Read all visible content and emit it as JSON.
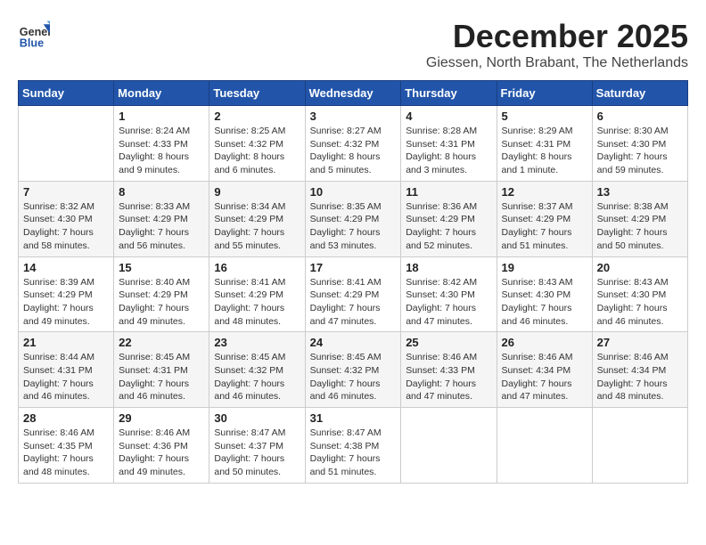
{
  "header": {
    "logo_line1": "General",
    "logo_line2": "Blue",
    "month_title": "December 2025",
    "subtitle": "Giessen, North Brabant, The Netherlands"
  },
  "days_of_week": [
    "Sunday",
    "Monday",
    "Tuesday",
    "Wednesday",
    "Thursday",
    "Friday",
    "Saturday"
  ],
  "weeks": [
    [
      {
        "day": "",
        "info": ""
      },
      {
        "day": "1",
        "info": "Sunrise: 8:24 AM\nSunset: 4:33 PM\nDaylight: 8 hours\nand 9 minutes."
      },
      {
        "day": "2",
        "info": "Sunrise: 8:25 AM\nSunset: 4:32 PM\nDaylight: 8 hours\nand 6 minutes."
      },
      {
        "day": "3",
        "info": "Sunrise: 8:27 AM\nSunset: 4:32 PM\nDaylight: 8 hours\nand 5 minutes."
      },
      {
        "day": "4",
        "info": "Sunrise: 8:28 AM\nSunset: 4:31 PM\nDaylight: 8 hours\nand 3 minutes."
      },
      {
        "day": "5",
        "info": "Sunrise: 8:29 AM\nSunset: 4:31 PM\nDaylight: 8 hours\nand 1 minute."
      },
      {
        "day": "6",
        "info": "Sunrise: 8:30 AM\nSunset: 4:30 PM\nDaylight: 7 hours\nand 59 minutes."
      }
    ],
    [
      {
        "day": "7",
        "info": "Sunrise: 8:32 AM\nSunset: 4:30 PM\nDaylight: 7 hours\nand 58 minutes."
      },
      {
        "day": "8",
        "info": "Sunrise: 8:33 AM\nSunset: 4:29 PM\nDaylight: 7 hours\nand 56 minutes."
      },
      {
        "day": "9",
        "info": "Sunrise: 8:34 AM\nSunset: 4:29 PM\nDaylight: 7 hours\nand 55 minutes."
      },
      {
        "day": "10",
        "info": "Sunrise: 8:35 AM\nSunset: 4:29 PM\nDaylight: 7 hours\nand 53 minutes."
      },
      {
        "day": "11",
        "info": "Sunrise: 8:36 AM\nSunset: 4:29 PM\nDaylight: 7 hours\nand 52 minutes."
      },
      {
        "day": "12",
        "info": "Sunrise: 8:37 AM\nSunset: 4:29 PM\nDaylight: 7 hours\nand 51 minutes."
      },
      {
        "day": "13",
        "info": "Sunrise: 8:38 AM\nSunset: 4:29 PM\nDaylight: 7 hours\nand 50 minutes."
      }
    ],
    [
      {
        "day": "14",
        "info": "Sunrise: 8:39 AM\nSunset: 4:29 PM\nDaylight: 7 hours\nand 49 minutes."
      },
      {
        "day": "15",
        "info": "Sunrise: 8:40 AM\nSunset: 4:29 PM\nDaylight: 7 hours\nand 49 minutes."
      },
      {
        "day": "16",
        "info": "Sunrise: 8:41 AM\nSunset: 4:29 PM\nDaylight: 7 hours\nand 48 minutes."
      },
      {
        "day": "17",
        "info": "Sunrise: 8:41 AM\nSunset: 4:29 PM\nDaylight: 7 hours\nand 47 minutes."
      },
      {
        "day": "18",
        "info": "Sunrise: 8:42 AM\nSunset: 4:30 PM\nDaylight: 7 hours\nand 47 minutes."
      },
      {
        "day": "19",
        "info": "Sunrise: 8:43 AM\nSunset: 4:30 PM\nDaylight: 7 hours\nand 46 minutes."
      },
      {
        "day": "20",
        "info": "Sunrise: 8:43 AM\nSunset: 4:30 PM\nDaylight: 7 hours\nand 46 minutes."
      }
    ],
    [
      {
        "day": "21",
        "info": "Sunrise: 8:44 AM\nSunset: 4:31 PM\nDaylight: 7 hours\nand 46 minutes."
      },
      {
        "day": "22",
        "info": "Sunrise: 8:45 AM\nSunset: 4:31 PM\nDaylight: 7 hours\nand 46 minutes."
      },
      {
        "day": "23",
        "info": "Sunrise: 8:45 AM\nSunset: 4:32 PM\nDaylight: 7 hours\nand 46 minutes."
      },
      {
        "day": "24",
        "info": "Sunrise: 8:45 AM\nSunset: 4:32 PM\nDaylight: 7 hours\nand 46 minutes."
      },
      {
        "day": "25",
        "info": "Sunrise: 8:46 AM\nSunset: 4:33 PM\nDaylight: 7 hours\nand 47 minutes."
      },
      {
        "day": "26",
        "info": "Sunrise: 8:46 AM\nSunset: 4:34 PM\nDaylight: 7 hours\nand 47 minutes."
      },
      {
        "day": "27",
        "info": "Sunrise: 8:46 AM\nSunset: 4:34 PM\nDaylight: 7 hours\nand 48 minutes."
      }
    ],
    [
      {
        "day": "28",
        "info": "Sunrise: 8:46 AM\nSunset: 4:35 PM\nDaylight: 7 hours\nand 48 minutes."
      },
      {
        "day": "29",
        "info": "Sunrise: 8:46 AM\nSunset: 4:36 PM\nDaylight: 7 hours\nand 49 minutes."
      },
      {
        "day": "30",
        "info": "Sunrise: 8:47 AM\nSunset: 4:37 PM\nDaylight: 7 hours\nand 50 minutes."
      },
      {
        "day": "31",
        "info": "Sunrise: 8:47 AM\nSunset: 4:38 PM\nDaylight: 7 hours\nand 51 minutes."
      },
      {
        "day": "",
        "info": ""
      },
      {
        "day": "",
        "info": ""
      },
      {
        "day": "",
        "info": ""
      }
    ]
  ]
}
